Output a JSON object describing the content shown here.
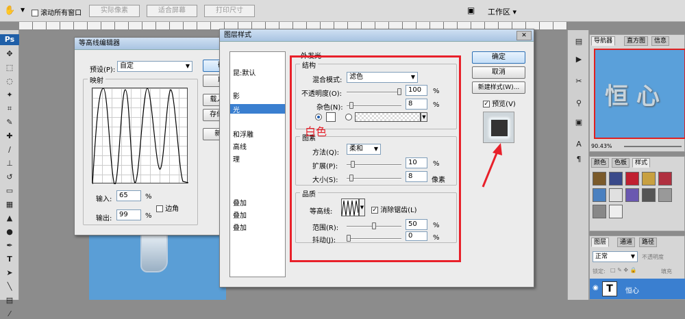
{
  "toolbar": {
    "scroll_all": "滚动所有窗口",
    "actual_pixels": "实际像素",
    "fit_screen": "适合屏幕",
    "print_size": "打印尺寸",
    "workspace": "工作区",
    "ps_logo": "Ps"
  },
  "contour_editor": {
    "title": "等高线编辑器",
    "preset_label": "预设(P):",
    "preset_value": "自定",
    "mapping_label": "映射",
    "input_label": "输入:",
    "input_value": "65",
    "output_label": "输出:",
    "output_value": "99",
    "percent": "%",
    "corner_label": "边角",
    "ok": "确定",
    "cancel": "取消",
    "load": "载入(L)...",
    "save": "存储(S)...",
    "new": "新建..."
  },
  "layer_style": {
    "title": "图层样式",
    "section_title": "外发光",
    "left_items": [
      "昆:默认",
      "影",
      "光",
      "和浮雕",
      "高线",
      "理",
      "",
      "叠加",
      "叠加",
      "叠加"
    ],
    "structure": {
      "title": "结构",
      "blend_label": "混合模式:",
      "blend_value": "滤色",
      "opacity_label": "不透明度(O):",
      "opacity_value": "100",
      "noise_label": "杂色(N):",
      "noise_value": "8",
      "percent": "%"
    },
    "annotation": "白色",
    "elements": {
      "title": "图素",
      "method_label": "方法(Q):",
      "method_value": "柔和",
      "spread_label": "扩展(P):",
      "spread_value": "10",
      "size_label": "大小(S):",
      "size_value": "8",
      "px": "像素"
    },
    "quality": {
      "title": "品质",
      "contour_label": "等高线:",
      "antialias_label": "消除锯齿(L)",
      "range_label": "范围(R):",
      "range_value": "50",
      "jitter_label": "抖动(J):",
      "jitter_value": "0"
    },
    "ok": "确定",
    "cancel": "取消",
    "new_style": "新建样式(W)...",
    "preview_label": "预览(V)"
  },
  "navigator": {
    "tabs": [
      "导航器",
      "直方图",
      "信息"
    ],
    "zoom": "90.43%",
    "preview_text": "恒 心"
  },
  "styles_panel": {
    "tabs": [
      "颜色",
      "色板",
      "样式"
    ]
  },
  "layers_panel": {
    "tabs": [
      "图层",
      "通道",
      "路径"
    ],
    "blend": "正常",
    "opacity_label": "不透明度",
    "lock_label": "锁定:",
    "fill_label": "填充",
    "layer_name": "恒心"
  }
}
